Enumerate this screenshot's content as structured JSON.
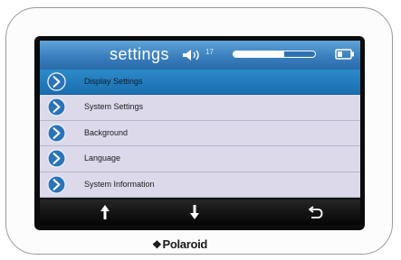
{
  "header": {
    "title": "settings",
    "volume_icon": "speaker-icon",
    "volume_value": "17",
    "volume_level": 0.62,
    "battery_icon": "battery-icon"
  },
  "menu": {
    "items": [
      {
        "label": "Display Settings",
        "icon": "chevron-right-icon",
        "selected": true
      },
      {
        "label": "System Settings",
        "icon": "chevron-right-icon",
        "selected": false
      },
      {
        "label": "Background",
        "icon": "chevron-right-icon",
        "selected": false
      },
      {
        "label": "Language",
        "icon": "chevron-right-icon",
        "selected": false
      },
      {
        "label": "System Information",
        "icon": "chevron-right-icon",
        "selected": false
      }
    ]
  },
  "navbar": {
    "up_icon": "arrow-up-icon",
    "down_icon": "arrow-down-icon",
    "back_icon": "return-icon"
  },
  "device": {
    "brand": "Polaroid",
    "brand_mark": "❖"
  },
  "colors": {
    "accent": "#2d8ac9",
    "row_bg": "#dcd9ea",
    "titlebar": "#3b7fbe"
  }
}
